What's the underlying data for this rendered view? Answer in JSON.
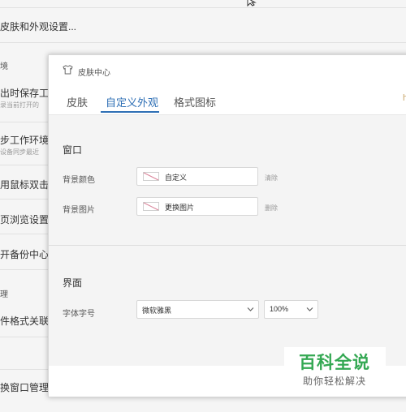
{
  "background": {
    "settings_title": "皮肤和外观设置...",
    "section_env": "境",
    "items": [
      {
        "label": "出时保存工",
        "sub": "录当前打开的"
      },
      {
        "label": "步工作环境",
        "sub": "设备同步最近"
      },
      {
        "label": "用鼠标双击",
        "sub": ""
      },
      {
        "label": "页浏览设置",
        "sub": ""
      },
      {
        "label": "开备份中心",
        "sub": ""
      }
    ],
    "section_manage": "理",
    "items2": [
      {
        "label": "件格式关联"
      },
      {
        "label": "换窗口管理"
      }
    ]
  },
  "dialog": {
    "title": "皮肤中心",
    "tabs": [
      {
        "label": "皮肤",
        "active": false
      },
      {
        "label": "自定义外观",
        "active": true
      },
      {
        "label": "格式图标",
        "active": false
      }
    ],
    "tab_edge": "h",
    "window_section": {
      "title": "窗口",
      "bg_color": {
        "label": "背景颜色",
        "value": "自定义",
        "action": "清除"
      },
      "bg_image": {
        "label": "背景图片",
        "value": "更换图片",
        "action": "删除"
      }
    },
    "interface_section": {
      "title": "界面",
      "font_label": "字体字号",
      "font_value": "微软雅黑",
      "size_value": "100%"
    }
  },
  "watermark": {
    "brand": "百科全说",
    "slogan": "助你轻松解决"
  },
  "colors": {
    "accent": "#2e6fb5",
    "watermark_green": "#34a853"
  },
  "icons": {
    "dialog_icon": "tshirt-icon",
    "cursor": "mouse-cursor-icon"
  }
}
